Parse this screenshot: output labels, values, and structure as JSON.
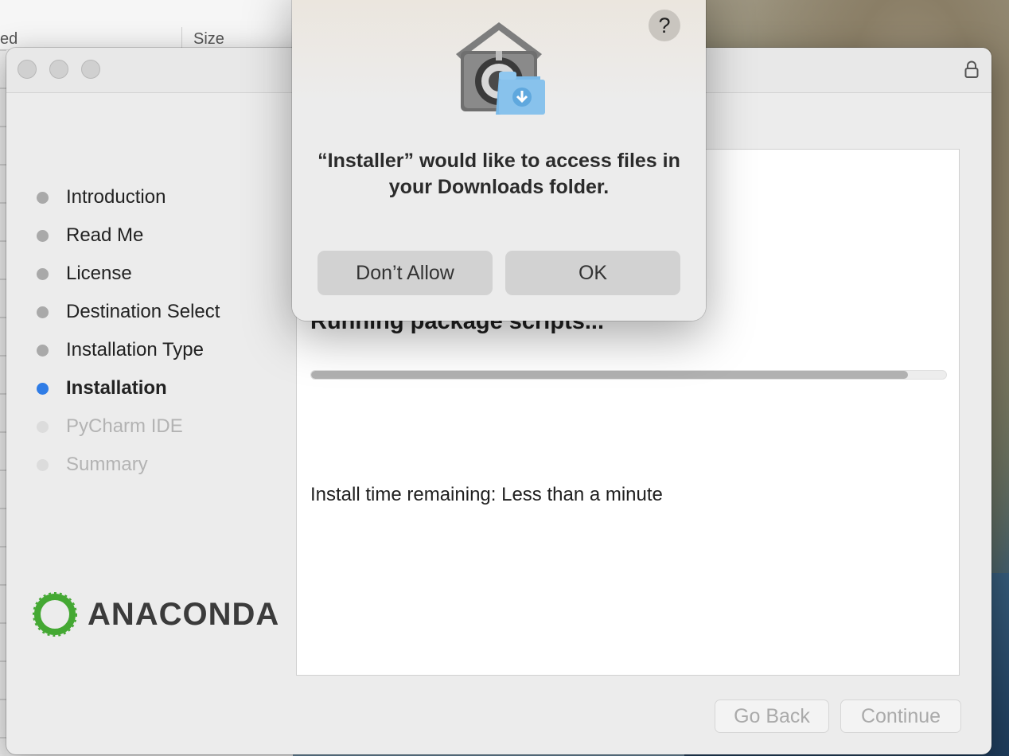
{
  "finder": {
    "column_partial": "ed",
    "column_size": "Size"
  },
  "installer": {
    "steps": [
      {
        "label": "Introduction",
        "state": "done"
      },
      {
        "label": "Read Me",
        "state": "done"
      },
      {
        "label": "License",
        "state": "done"
      },
      {
        "label": "Destination Select",
        "state": "done"
      },
      {
        "label": "Installation Type",
        "state": "done"
      },
      {
        "label": "Installation",
        "state": "active"
      },
      {
        "label": "PyCharm IDE",
        "state": "future"
      },
      {
        "label": "Summary",
        "state": "future"
      }
    ],
    "logo_text": "ANACONDA",
    "status_text": "Running package scripts...",
    "progress_fraction": 0.94,
    "time_remaining": "Install time remaining: Less than a minute",
    "go_back_label": "Go Back",
    "continue_label": "Continue",
    "colors": {
      "active_bullet": "#2f7ce6",
      "done_bullet": "#a9a9a9",
      "future_bullet": "#dcdcdc"
    }
  },
  "dialog": {
    "help_label": "?",
    "message": "“Installer” would like to access files in your Downloads folder.",
    "dont_allow_label": "Don’t Allow",
    "ok_label": "OK",
    "icon": "privacy-downloads-folder-icon"
  }
}
